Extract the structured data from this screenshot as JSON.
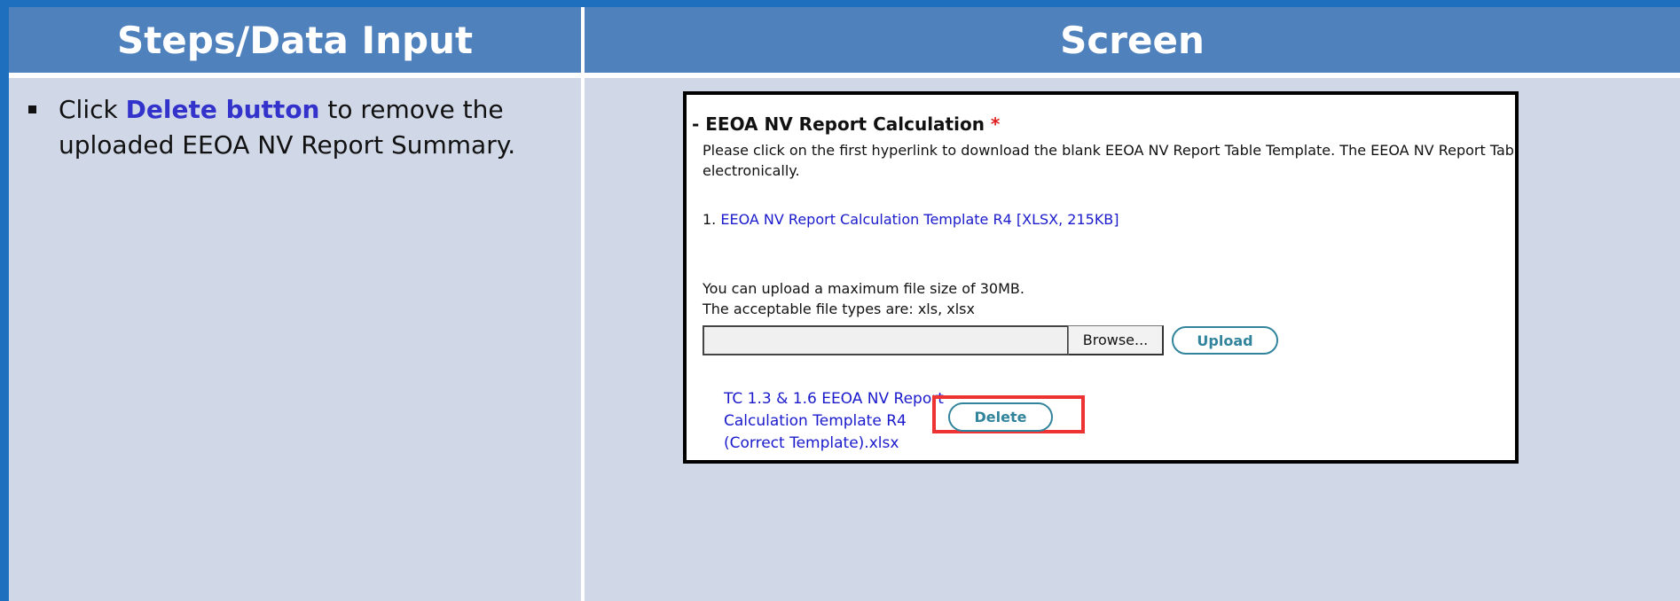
{
  "headers": {
    "steps": "Steps/Data Input",
    "screen": "Screen"
  },
  "step": {
    "prefix": "Click ",
    "highlight": "Delete button",
    "suffix": " to remove the uploaded EEOA NV Report Summary."
  },
  "screenshot": {
    "section_title_prefix": "- EEOA NV Report Calculation ",
    "required_mark": "*",
    "instruction_line1": "Please click on the first hyperlink to download the blank EEOA NV Report Table Template. The EEOA NV Report Table",
    "instruction_line2": "electronically.",
    "template_number": "1. ",
    "template_link": "EEOA NV Report Calculation Template R4 [XLSX, 215KB]",
    "upload_note_line1": "You can upload a maximum file size of 30MB.",
    "upload_note_line2": "The acceptable file types are: xls, xlsx",
    "file_input_value": "",
    "browse_label": "Browse...",
    "upload_label": "Upload",
    "uploaded_file": "TC 1.3 & 1.6 EEOA NV Report Calculation Template R4 (Correct Template).xlsx",
    "delete_label": "Delete"
  },
  "colors": {
    "header_bg": "#4f81bd",
    "cell_bg": "#d0d8e8",
    "highlight_text": "#3333cc",
    "link": "#1a1acc",
    "button_accent": "#31849b",
    "callout_box": "#ee3333"
  }
}
